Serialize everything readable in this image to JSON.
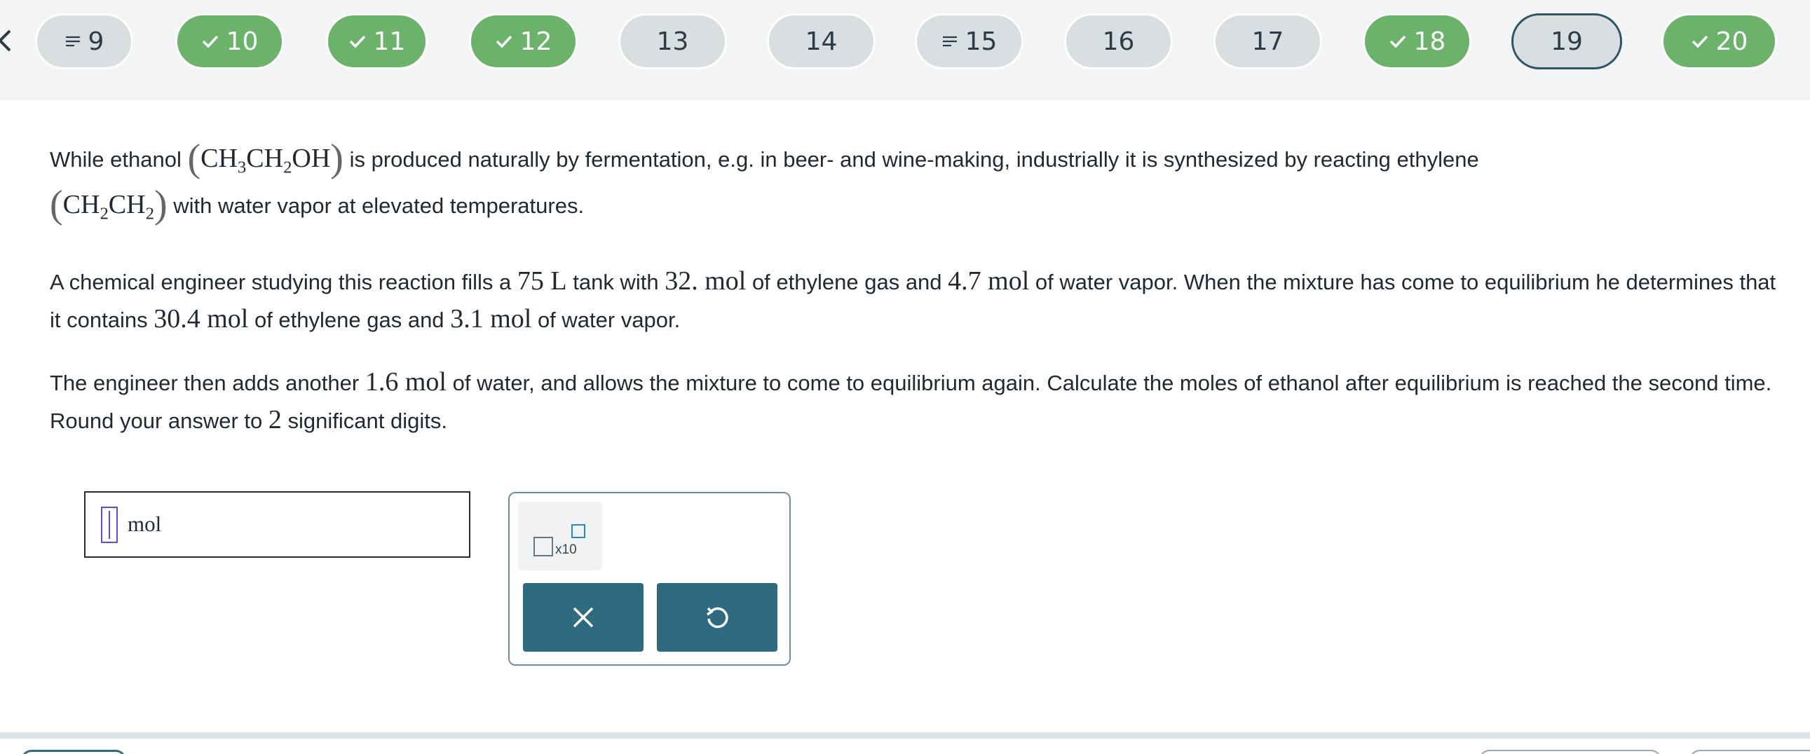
{
  "nav": {
    "pills": [
      {
        "label": "9",
        "status": "partial",
        "icon": "list-icon"
      },
      {
        "label": "10",
        "status": "done",
        "icon": "check-icon"
      },
      {
        "label": "11",
        "status": "done",
        "icon": "check-icon"
      },
      {
        "label": "12",
        "status": "done",
        "icon": "check-icon"
      },
      {
        "label": "13",
        "status": "todo",
        "icon": ""
      },
      {
        "label": "14",
        "status": "todo",
        "icon": ""
      },
      {
        "label": "15",
        "status": "partial",
        "icon": "list-icon"
      },
      {
        "label": "16",
        "status": "todo",
        "icon": ""
      },
      {
        "label": "17",
        "status": "todo",
        "icon": ""
      },
      {
        "label": "18",
        "status": "done",
        "icon": "check-icon"
      },
      {
        "label": "19",
        "status": "current",
        "icon": ""
      },
      {
        "label": "20",
        "status": "done",
        "icon": "check-icon"
      }
    ],
    "back_icon": "chevron-left-icon"
  },
  "colors": {
    "done_green": "#6bb36b",
    "pill_gray": "#d9dee1",
    "current_border": "#2e5566",
    "tool_teal": "#2e6b7e",
    "cursor_purple": "#5a4fe0"
  },
  "question": {
    "p1_a": "While ethanol",
    "ethanol_formula": [
      "CH",
      "3",
      "CH",
      "2",
      "OH"
    ],
    "p1_b": "is produced naturally by fermentation, e.g. in beer- and wine-making, industrially it is synthesized by reacting ethylene",
    "ethylene_formula": [
      "CH",
      "2",
      "CH",
      "2"
    ],
    "p1_c": "with water vapor at elevated temperatures.",
    "p2_a": "A chemical engineer studying this reaction fills a",
    "tank_volume": "75 L",
    "p2_b": "tank with",
    "ethylene_initial": "32. mol",
    "p2_c": "of ethylene gas and",
    "water_initial": "4.7 mol",
    "p2_d": "of water vapor. When the mixture has come to equilibrium he determines that it contains",
    "ethylene_eq": "30.4 mol",
    "p2_e": "of ethylene gas and",
    "water_eq": "3.1 mol",
    "p2_f": "of water vapor.",
    "p3_a": "The engineer then adds another",
    "water_added": "1.6 mol",
    "p3_b": "of water, and allows the mixture to come to equilibrium again. Calculate the moles of ethanol after equilibrium is reached the second time. Round your answer to",
    "sig_digits": "2",
    "p3_c": "significant digits."
  },
  "answer": {
    "value": "",
    "unit": "mol"
  },
  "palette": {
    "sci_label": "x10",
    "clear_icon": "close-icon",
    "undo_icon": "undo-icon"
  }
}
